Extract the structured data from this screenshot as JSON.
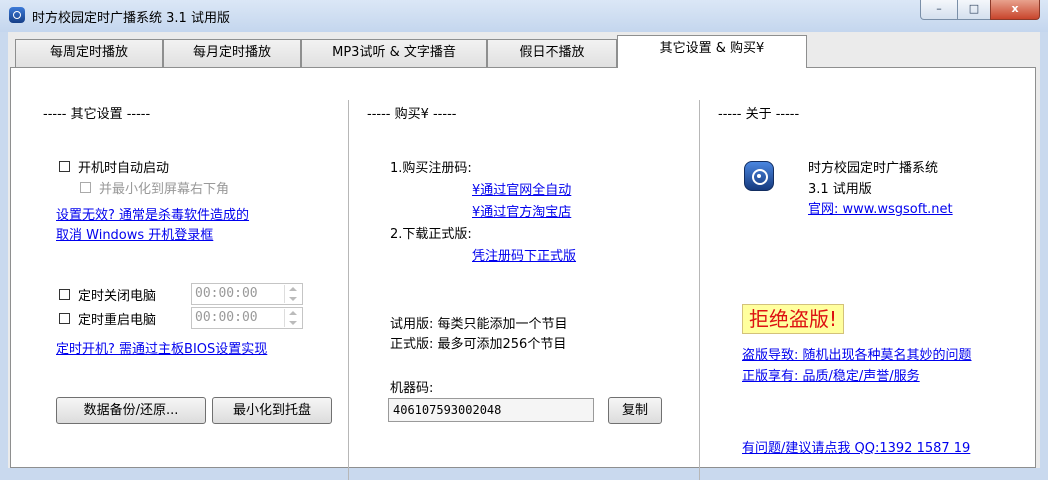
{
  "window": {
    "title": "时方校园定时广播系统 3.1 试用版",
    "min": "–",
    "max": "□",
    "close": "x"
  },
  "tabs": [
    {
      "label": "每周定时播放"
    },
    {
      "label": "每月定时播放"
    },
    {
      "label": "MP3试听 & 文字播音"
    },
    {
      "label": "假日不播放"
    },
    {
      "label": "其它设置 & 购买¥"
    }
  ],
  "settings": {
    "heading": "----- 其它设置 -----",
    "autostart_label": "开机时自动启动",
    "autostart_checked": false,
    "minimize_label": "并最小化到屏幕右下角",
    "minimize_checked": false,
    "link_invalid": "设置无效? 通常是杀毒软件造成的",
    "link_cancel_login": "取消 Windows 开机登录框",
    "shutdown_label": "定时关闭电脑",
    "shutdown_time": "00:00:00",
    "restart_label": "定时重启电脑",
    "restart_time": "00:00:00",
    "link_bios": "定时开机? 需通过主板BIOS设置实现",
    "backup_button": "数据备份/还原...",
    "tray_button": "最小化到托盘"
  },
  "buy": {
    "heading": "----- 购买¥ -----",
    "step1": "1.购买注册码:",
    "link_official": "¥通过官网全自动",
    "link_taobao": "¥通过官方淘宝店",
    "step2": "2.下载正式版:",
    "link_download": "凭注册码下正式版",
    "trial_note": "试用版: 每类只能添加一个节目",
    "full_note": "正式版: 最多可添加256个节目",
    "machine_label": "机器码:",
    "machine_code": "406107593002048",
    "copy_button": "复制"
  },
  "about": {
    "heading": "----- 关于 -----",
    "app_name": "时方校园定时广播系统",
    "version": "3.1 试用版",
    "website": "官网: www.wsgsoft.net",
    "piracy_banner": "拒绝盗版!",
    "piracy_link": "盗版导致: 随机出现各种莫名其妙的问题",
    "genuine_link": "正版享有: 品质/稳定/声誉/服务",
    "feedback_link": "有问题/建议请点我 QQ:1392 1587 19"
  }
}
